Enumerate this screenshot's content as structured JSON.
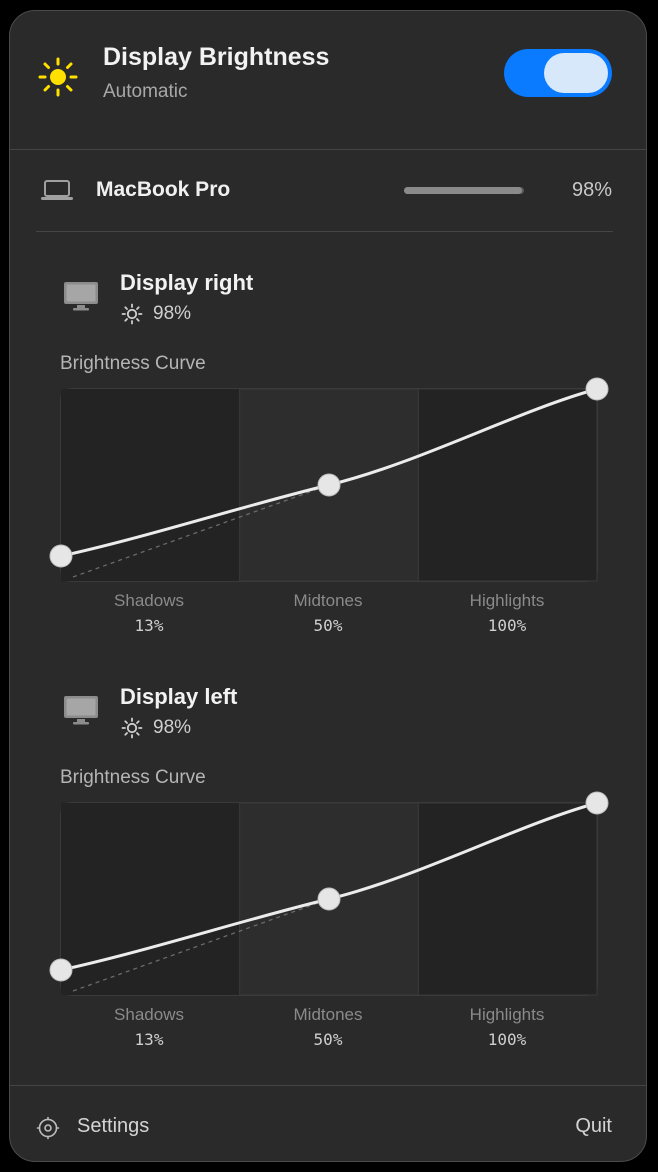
{
  "header": {
    "title": "Display Brightness",
    "subtitle": "Automatic",
    "toggle_on": true,
    "accent_color": "#0a7aff"
  },
  "builtin": {
    "name": "MacBook Pro",
    "brightness_fraction": 0.98,
    "brightness_label": "98%"
  },
  "displays": [
    {
      "name": "Display right",
      "brightness_label": "98%",
      "curve_title": "Brightness Curve",
      "zones": [
        {
          "label": "Shadows",
          "value": "13%"
        },
        {
          "label": "Midtones",
          "value": "50%"
        },
        {
          "label": "Highlights",
          "value": "100%"
        }
      ],
      "curve_points": [
        [
          0,
          0.13
        ],
        [
          0.5,
          0.5
        ],
        [
          1,
          1
        ]
      ]
    },
    {
      "name": "Display left",
      "brightness_label": "98%",
      "curve_title": "Brightness Curve",
      "zones": [
        {
          "label": "Shadows",
          "value": "13%"
        },
        {
          "label": "Midtones",
          "value": "50%"
        },
        {
          "label": "Highlights",
          "value": "100%"
        }
      ],
      "curve_points": [
        [
          0,
          0.13
        ],
        [
          0.5,
          0.5
        ],
        [
          1,
          1
        ]
      ]
    }
  ],
  "footer": {
    "settings_label": "Settings",
    "quit_label": "Quit",
    "settings_icon": "gear-icon"
  },
  "icons": {
    "header": "sun-icon",
    "builtin": "laptop-icon",
    "external": "monitor-icon",
    "brightness": "sun-small-icon"
  }
}
